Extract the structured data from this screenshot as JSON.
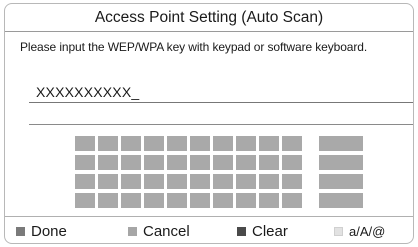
{
  "dialog": {
    "title": "Access Point Setting (Auto Scan)",
    "prompt": "Please input the WEP/WPA key with keypad or software keyboard.",
    "key_value": "XXXXXXXXXX_"
  },
  "keyboard": {
    "rows": 4,
    "narrow_keys_per_row": 10,
    "wide_keys_per_row": 1,
    "key_color": "#a9a9a9"
  },
  "footer": {
    "items": [
      {
        "label": "Done",
        "color": "#7a7a7a"
      },
      {
        "label": "Cancel",
        "color": "#a6a6a6"
      },
      {
        "label": "Clear",
        "color": "#4a4a4a"
      },
      {
        "label": "a/A/@",
        "color": "#e2e2e2"
      }
    ]
  }
}
